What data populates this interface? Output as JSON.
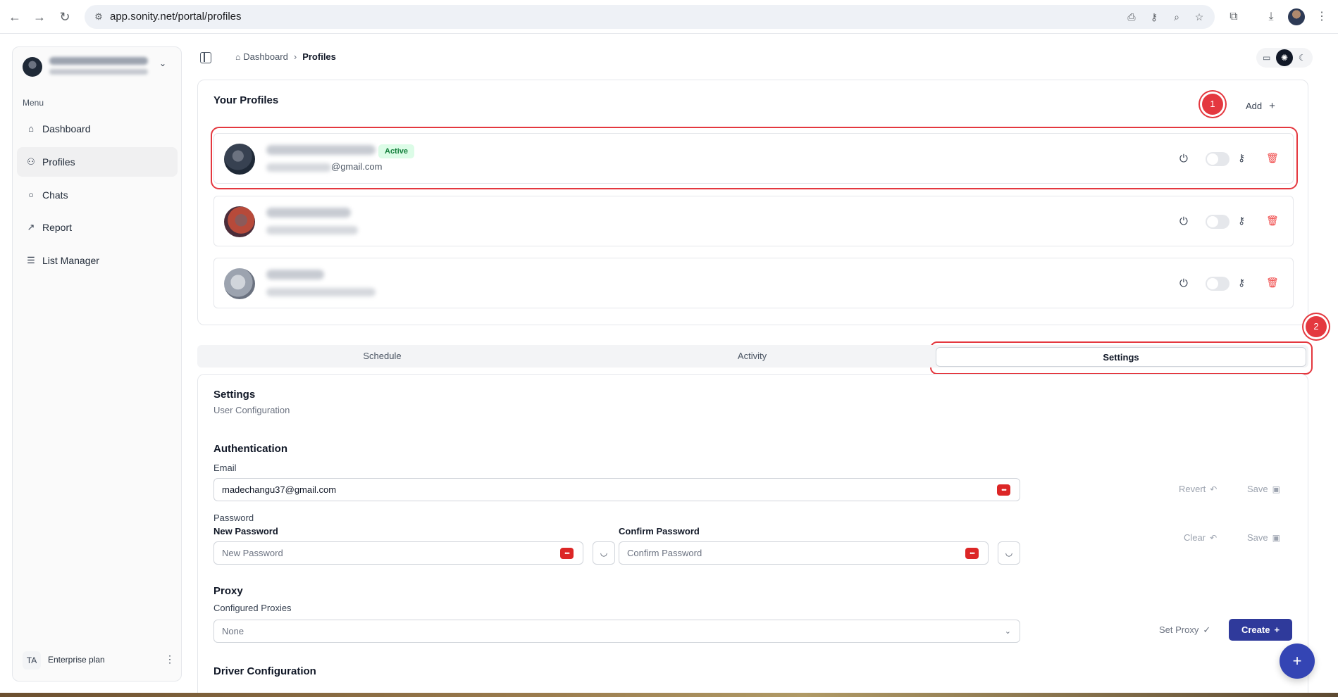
{
  "browser": {
    "url": "app.sonity.net/portal/profiles",
    "icons": [
      "back-icon",
      "forward-icon",
      "reload-icon",
      "site-info-icon",
      "install-icon",
      "password-key-icon",
      "zoom-icon",
      "star-icon",
      "extensions-icon",
      "download-icon",
      "profile-icon",
      "more-vert-icon"
    ]
  },
  "sidebar": {
    "menu_label": "Menu",
    "items": [
      {
        "label": "Dashboard",
        "icon": "home-icon"
      },
      {
        "label": "Profiles",
        "icon": "users-icon"
      },
      {
        "label": "Chats",
        "icon": "chat-icon"
      },
      {
        "label": "Report",
        "icon": "chart-icon"
      },
      {
        "label": "List Manager",
        "icon": "list-icon"
      }
    ],
    "plan": {
      "initials": "TA",
      "label": "Enterprise plan"
    }
  },
  "header": {
    "breadcrumb": {
      "parent": "Dashboard",
      "current": "Profiles"
    },
    "theme_options": [
      "monitor-icon",
      "sun-icon",
      "moon-icon"
    ],
    "theme_selected": "sun-icon"
  },
  "profiles_card": {
    "title": "Your Profiles",
    "add_label": "Add",
    "profiles": [
      {
        "status_badge": "Active",
        "email_visible": "@gmail.com",
        "enabled": false
      },
      {
        "status_badge": "",
        "email_visible": "",
        "enabled": false
      },
      {
        "status_badge": "",
        "email_visible": "",
        "enabled": false
      }
    ]
  },
  "annotations": {
    "marker_1": "1",
    "marker_2": "2",
    "color": "#e4383f"
  },
  "tabs": {
    "items": [
      "Schedule",
      "Activity",
      "Settings"
    ],
    "selected": "Settings"
  },
  "settings": {
    "title": "Settings",
    "subtitle": "User Configuration",
    "auth": {
      "heading": "Authentication",
      "email_label": "Email",
      "email_value": "madechangu37@gmail.com",
      "revert_label": "Revert",
      "save_label": "Save",
      "password_label": "Password",
      "new_password_label": "New Password",
      "new_password_placeholder": "New Password",
      "confirm_password_label": "Confirm Password",
      "confirm_password_placeholder": "Confirm Password",
      "clear_label": "Clear",
      "save2_label": "Save"
    },
    "proxy": {
      "heading": "Proxy",
      "configured_label": "Configured Proxies",
      "selected": "None",
      "set_proxy_label": "Set Proxy",
      "create_label": "Create"
    },
    "driver_heading": "Driver Configuration"
  },
  "colors": {
    "accent": "#2f3a9b",
    "danger": "#ef4444",
    "active_badge_bg": "#dcfce7",
    "active_badge_text": "#15803d"
  }
}
